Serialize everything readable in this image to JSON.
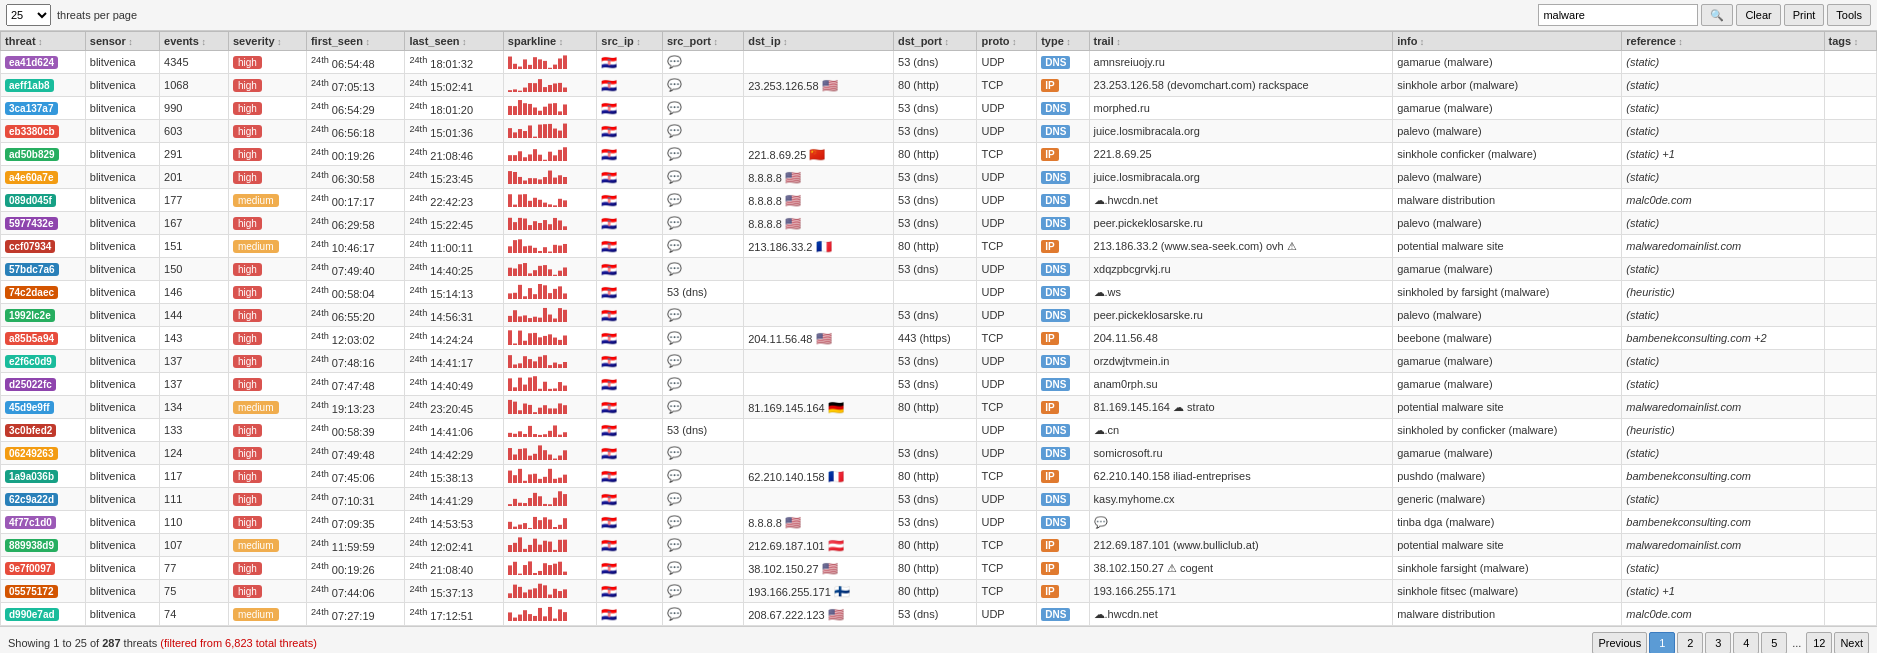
{
  "topbar": {
    "per_page": "25",
    "per_page_label": "threats per page",
    "search_value": "malware",
    "search_placeholder": "Search...",
    "clear_label": "Clear",
    "print_label": "Print",
    "tools_label": "Tools"
  },
  "columns": [
    "threat",
    "sensor",
    "events",
    "severity",
    "first_seen",
    "last_seen",
    "sparkline",
    "src_ip",
    "src_port",
    "dst_ip",
    "dst_port",
    "proto",
    "type",
    "trail",
    "info",
    "reference",
    "tags"
  ],
  "rows": [
    {
      "id": "ea41d624",
      "color": 0,
      "sensor": "blitvenica",
      "events": "4345",
      "severity": "high",
      "first_seen": "24th 06:54:48",
      "last_seen": "24th 18:01:32",
      "src_ip": "",
      "src_flag": "🇭🇷",
      "src_port": "",
      "chat": "💬",
      "dst_ip": "",
      "dst_flag": "",
      "dst_port": "53 (dns)",
      "proto": "UDP",
      "type": "DNS",
      "trail": "amnsreiuojy.ru",
      "info": "gamarue (malware)",
      "reference": "(static)",
      "tags": ""
    },
    {
      "id": "aeff1ab8",
      "color": 1,
      "sensor": "blitvenica",
      "events": "1068",
      "severity": "high",
      "first_seen": "24th 07:05:13",
      "last_seen": "24th 15:02:41",
      "src_ip": "",
      "src_flag": "🇭🇷",
      "src_port": "",
      "chat": "💬",
      "dst_ip": "23.253.126.58",
      "dst_flag": "🇺🇸",
      "dst_port": "80 (http)",
      "proto": "TCP",
      "type": "IP",
      "trail": "23.253.126.58 (devomchart.com) rackspace",
      "info": "sinkhole arbor (malware)",
      "reference": "(static)",
      "tags": ""
    },
    {
      "id": "3ca137a7",
      "color": 2,
      "sensor": "blitvenica",
      "events": "990",
      "severity": "high",
      "first_seen": "24th 06:54:29",
      "last_seen": "24th 18:01:20",
      "src_ip": "",
      "src_flag": "🇭🇷",
      "src_port": "",
      "chat": "💬",
      "dst_ip": "",
      "dst_flag": "",
      "dst_port": "53 (dns)",
      "proto": "UDP",
      "type": "DNS",
      "trail": "morphed.ru",
      "info": "gamarue (malware)",
      "reference": "(static)",
      "tags": ""
    },
    {
      "id": "eb3380cb",
      "color": 3,
      "sensor": "blitvenica",
      "events": "603",
      "severity": "high",
      "first_seen": "24th 06:56:18",
      "last_seen": "24th 15:01:36",
      "src_ip": "",
      "src_flag": "🇭🇷",
      "src_port": "",
      "chat": "💬",
      "dst_ip": "",
      "dst_flag": "",
      "dst_port": "53 (dns)",
      "proto": "UDP",
      "type": "DNS",
      "trail": "juice.losmibracala.org",
      "info": "palevo (malware)",
      "reference": "(static)",
      "tags": ""
    },
    {
      "id": "ad50b829",
      "color": 4,
      "sensor": "blitvenica",
      "events": "291",
      "severity": "high",
      "first_seen": "24th 00:19:26",
      "last_seen": "24th 21:08:46",
      "src_ip": "",
      "src_flag": "🇭🇷",
      "src_port": "",
      "chat": "💬",
      "dst_ip": "221.8.69.25",
      "dst_flag": "🇨🇳",
      "dst_port": "80 (http)",
      "proto": "TCP",
      "type": "IP",
      "trail": "221.8.69.25",
      "info": "sinkhole conficker (malware)",
      "reference": "(static) +1",
      "tags": ""
    },
    {
      "id": "a4e60a7e",
      "color": 5,
      "sensor": "blitvenica",
      "events": "201",
      "severity": "high",
      "first_seen": "24th 06:30:58",
      "last_seen": "24th 15:23:45",
      "src_ip": "",
      "src_flag": "🇭🇷",
      "src_port": "",
      "chat": "💬",
      "dst_ip": "8.8.8.8",
      "dst_flag": "🇺🇸",
      "dst_port": "53 (dns)",
      "proto": "UDP",
      "type": "DNS",
      "trail": "juice.losmibracala.org",
      "info": "palevo (malware)",
      "reference": "(static)",
      "tags": ""
    },
    {
      "id": "089d045f",
      "color": 6,
      "sensor": "blitvenica",
      "events": "177",
      "severity": "medium",
      "first_seen": "24th 00:17:17",
      "last_seen": "24th 22:42:23",
      "src_ip": "",
      "src_flag": "🇭🇷",
      "src_port": "",
      "chat": "💬",
      "dst_ip": "8.8.8.8",
      "dst_flag": "🇺🇸",
      "dst_port": "53 (dns)",
      "proto": "UDP",
      "type": "DNS",
      "trail": "☁.hwcdn.net",
      "info": "malware distribution",
      "reference": "malc0de.com",
      "tags": ""
    },
    {
      "id": "5977432e",
      "color": 7,
      "sensor": "blitvenica",
      "events": "167",
      "severity": "high",
      "first_seen": "24th 06:29:58",
      "last_seen": "24th 15:22:45",
      "src_ip": "",
      "src_flag": "🇭🇷",
      "src_port": "",
      "chat": "💬",
      "dst_ip": "8.8.8.8",
      "dst_flag": "🇺🇸",
      "dst_port": "53 (dns)",
      "proto": "UDP",
      "type": "DNS",
      "trail": "peer.pickeklosarske.ru",
      "info": "palevo (malware)",
      "reference": "(static)",
      "tags": ""
    },
    {
      "id": "ccf07934",
      "color": 8,
      "sensor": "blitvenica",
      "events": "151",
      "severity": "medium",
      "first_seen": "24th 10:46:17",
      "last_seen": "24th 11:00:11",
      "src_ip": "",
      "src_flag": "🇭🇷",
      "src_port": "",
      "chat": "💬",
      "dst_ip": "213.186.33.2",
      "dst_flag": "🇫🇷",
      "dst_port": "80 (http)",
      "proto": "TCP",
      "type": "IP",
      "trail": "213.186.33.2 (www.sea-seek.com) ovh ⚠",
      "info": "potential malware site",
      "reference": "malwaredomainlist.com",
      "tags": ""
    },
    {
      "id": "57bdc7a6",
      "color": 9,
      "sensor": "blitvenica",
      "events": "150",
      "severity": "high",
      "first_seen": "24th 07:49:40",
      "last_seen": "24th 14:40:25",
      "src_ip": "",
      "src_flag": "🇭🇷",
      "src_port": "",
      "chat": "💬",
      "dst_ip": "",
      "dst_flag": "",
      "dst_port": "53 (dns)",
      "proto": "UDP",
      "type": "DNS",
      "trail": "xdqzpbcgrvkj.ru",
      "info": "gamarue (malware)",
      "reference": "(static)",
      "tags": ""
    },
    {
      "id": "74c2daec",
      "color": 10,
      "sensor": "blitvenica",
      "events": "146",
      "severity": "high",
      "first_seen": "24th 00:58:04",
      "last_seen": "24th 15:14:13",
      "src_ip": "",
      "src_flag": "🇭🇷",
      "src_port": "53 (dns)",
      "chat": "💬",
      "dst_ip": "",
      "dst_flag": "",
      "dst_port": "",
      "proto": "UDP",
      "type": "DNS",
      "trail": "☁.ws",
      "info": "sinkholed by farsight (malware)",
      "reference": "(heuristic)",
      "tags": ""
    },
    {
      "id": "1992lc2e",
      "color": 11,
      "sensor": "blitvenica",
      "events": "144",
      "severity": "high",
      "first_seen": "24th 06:55:20",
      "last_seen": "24th 14:56:31",
      "src_ip": "",
      "src_flag": "🇭🇷",
      "src_port": "",
      "chat": "💬",
      "dst_ip": "",
      "dst_flag": "",
      "dst_port": "53 (dns)",
      "proto": "UDP",
      "type": "DNS",
      "trail": "peer.pickeklosarske.ru",
      "info": "palevo (malware)",
      "reference": "(static)",
      "tags": ""
    },
    {
      "id": "a85b5a94",
      "color": 12,
      "sensor": "blitvenica",
      "events": "143",
      "severity": "high",
      "first_seen": "24th 12:03:02",
      "last_seen": "24th 14:24:24",
      "src_ip": "",
      "src_flag": "🇭🇷",
      "src_port": "",
      "chat": "💬",
      "dst_ip": "204.11.56.48",
      "dst_flag": "🇺🇸",
      "dst_port": "443 (https)",
      "proto": "TCP",
      "type": "IP",
      "trail": "204.11.56.48",
      "info": "beebone (malware)",
      "reference": "bambenekconsulting.com +2",
      "tags": ""
    },
    {
      "id": "e2f6c0d9",
      "color": 13,
      "sensor": "blitvenica",
      "events": "137",
      "severity": "high",
      "first_seen": "24th 07:48:16",
      "last_seen": "24th 14:41:17",
      "src_ip": "",
      "src_flag": "🇭🇷",
      "src_port": "",
      "chat": "💬",
      "dst_ip": "",
      "dst_flag": "",
      "dst_port": "53 (dns)",
      "proto": "UDP",
      "type": "DNS",
      "trail": "orzdwjtvmein.in",
      "info": "gamarue (malware)",
      "reference": "(static)",
      "tags": ""
    },
    {
      "id": "d25022fc",
      "color": 14,
      "sensor": "blitvenica",
      "events": "137",
      "severity": "high",
      "first_seen": "24th 07:47:48",
      "last_seen": "24th 14:40:49",
      "src_ip": "",
      "src_flag": "🇭🇷",
      "src_port": "",
      "chat": "💬",
      "dst_ip": "",
      "dst_flag": "",
      "dst_port": "53 (dns)",
      "proto": "UDP",
      "type": "DNS",
      "trail": "anam0rph.su",
      "info": "gamarue (malware)",
      "reference": "(static)",
      "tags": ""
    },
    {
      "id": "45d9e9ff",
      "color": 15,
      "sensor": "blitvenica",
      "events": "134",
      "severity": "medium",
      "first_seen": "24th 19:13:23",
      "last_seen": "24th 23:20:45",
      "src_ip": "",
      "src_flag": "🇭🇷",
      "src_port": "",
      "chat": "💬",
      "dst_ip": "81.169.145.164",
      "dst_flag": "🇩🇪",
      "dst_port": "80 (http)",
      "proto": "TCP",
      "type": "IP",
      "trail": "81.169.145.164 ☁ strato",
      "info": "potential malware site",
      "reference": "malwaredomainlist.com",
      "tags": ""
    },
    {
      "id": "3c0bfed2",
      "color": 16,
      "sensor": "blitvenica",
      "events": "133",
      "severity": "high",
      "first_seen": "24th 00:58:39",
      "last_seen": "24th 14:41:06",
      "src_ip": "",
      "src_flag": "🇭🇷",
      "src_port": "53 (dns)",
      "chat": "💬",
      "dst_ip": "",
      "dst_flag": "",
      "dst_port": "",
      "proto": "UDP",
      "type": "DNS",
      "trail": "☁.cn",
      "info": "sinkholed by conficker (malware)",
      "reference": "(heuristic)",
      "tags": ""
    },
    {
      "id": "06249263",
      "color": 17,
      "sensor": "blitvenica",
      "events": "124",
      "severity": "high",
      "first_seen": "24th 07:49:48",
      "last_seen": "24th 14:42:29",
      "src_ip": "",
      "src_flag": "🇭🇷",
      "src_port": "",
      "chat": "💬",
      "dst_ip": "",
      "dst_flag": "",
      "dst_port": "53 (dns)",
      "proto": "UDP",
      "type": "DNS",
      "trail": "somicrosoft.ru",
      "info": "gamarue (malware)",
      "reference": "(static)",
      "tags": ""
    },
    {
      "id": "1a9a036b",
      "color": 18,
      "sensor": "blitvenica",
      "events": "117",
      "severity": "high",
      "first_seen": "24th 07:45:06",
      "last_seen": "24th 15:38:13",
      "src_ip": "",
      "src_flag": "🇭🇷",
      "src_port": "",
      "chat": "💬",
      "dst_ip": "62.210.140.158",
      "dst_flag": "🇫🇷",
      "dst_port": "80 (http)",
      "proto": "TCP",
      "type": "IP",
      "trail": "62.210.140.158 iliad-entreprises",
      "info": "pushdo (malware)",
      "reference": "bambenekconsulting.com",
      "tags": ""
    },
    {
      "id": "62c9a22d",
      "color": 19,
      "sensor": "blitvenica",
      "events": "111",
      "severity": "high",
      "first_seen": "24th 07:10:31",
      "last_seen": "24th 14:41:29",
      "src_ip": "",
      "src_flag": "🇭🇷",
      "src_port": "",
      "chat": "💬",
      "dst_ip": "",
      "dst_flag": "",
      "dst_port": "53 (dns)",
      "proto": "UDP",
      "type": "DNS",
      "trail": "kasy.myhome.cx",
      "info": "generic (malware)",
      "reference": "(static)",
      "tags": ""
    },
    {
      "id": "4f77c1d0",
      "color": 20,
      "sensor": "blitvenica",
      "events": "110",
      "severity": "high",
      "first_seen": "24th 07:09:35",
      "last_seen": "24th 14:53:53",
      "src_ip": "",
      "src_flag": "🇭🇷",
      "src_port": "",
      "chat": "💬",
      "dst_ip": "8.8.8.8",
      "dst_flag": "🇺🇸",
      "dst_port": "53 (dns)",
      "proto": "UDP",
      "type": "DNS",
      "trail": "💬",
      "info": "tinba dga (malware)",
      "reference": "bambenekconsulting.com",
      "tags": ""
    },
    {
      "id": "889938d9",
      "color": 21,
      "sensor": "blitvenica",
      "events": "107",
      "severity": "medium",
      "first_seen": "24th 11:59:59",
      "last_seen": "24th 12:02:41",
      "src_ip": "",
      "src_flag": "🇭🇷",
      "src_port": "",
      "chat": "💬",
      "dst_ip": "212.69.187.101",
      "dst_flag": "🇦🇹",
      "dst_port": "80 (http)",
      "proto": "TCP",
      "type": "IP",
      "trail": "212.69.187.101 (www.bulliclub.at)",
      "info": "potential malware site",
      "reference": "malwaredomainlist.com",
      "tags": ""
    },
    {
      "id": "9e7f0097",
      "color": 22,
      "sensor": "blitvenica",
      "events": "77",
      "severity": "high",
      "first_seen": "24th 00:19:26",
      "last_seen": "24th 21:08:40",
      "src_ip": "",
      "src_flag": "🇭🇷",
      "src_port": "",
      "chat": "💬",
      "dst_ip": "38.102.150.27",
      "dst_flag": "🇺🇸",
      "dst_port": "80 (http)",
      "proto": "TCP",
      "type": "IP",
      "trail": "38.102.150.27 ⚠ cogent",
      "info": "sinkhole farsight (malware)",
      "reference": "(static)",
      "tags": ""
    },
    {
      "id": "05575172",
      "color": 23,
      "sensor": "blitvenica",
      "events": "75",
      "severity": "high",
      "first_seen": "24th 07:44:06",
      "last_seen": "24th 15:37:13",
      "src_ip": "",
      "src_flag": "🇭🇷",
      "src_port": "",
      "chat": "💬",
      "dst_ip": "193.166.255.171",
      "dst_flag": "🇫🇮",
      "dst_port": "80 (http)",
      "proto": "TCP",
      "type": "IP",
      "trail": "193.166.255.171",
      "info": "sinkhole fitsec (malware)",
      "reference": "(static) +1",
      "tags": ""
    },
    {
      "id": "d990e7ad",
      "color": 24,
      "sensor": "blitvenica",
      "events": "74",
      "severity": "medium",
      "first_seen": "24th 07:27:19",
      "last_seen": "24th 17:12:51",
      "src_ip": "",
      "src_flag": "🇭🇷",
      "src_port": "",
      "chat": "💬",
      "dst_ip": "208.67.222.123",
      "dst_flag": "🇺🇸",
      "dst_port": "53 (dns)",
      "proto": "UDP",
      "type": "DNS",
      "trail": "☁.hwcdn.net",
      "info": "malware distribution",
      "reference": "malc0de.com",
      "tags": ""
    }
  ],
  "bottom": {
    "showing": "Showing 1 to 25 of",
    "total": "287",
    "threats_label": "threats",
    "filtered_label": "(filtered from 6,823 total threats)",
    "prev_label": "Previous",
    "next_label": "Next",
    "pages": [
      "1",
      "2",
      "3",
      "4",
      "5"
    ],
    "ellipsis": "...",
    "last_page": "12",
    "current_page": "1"
  }
}
